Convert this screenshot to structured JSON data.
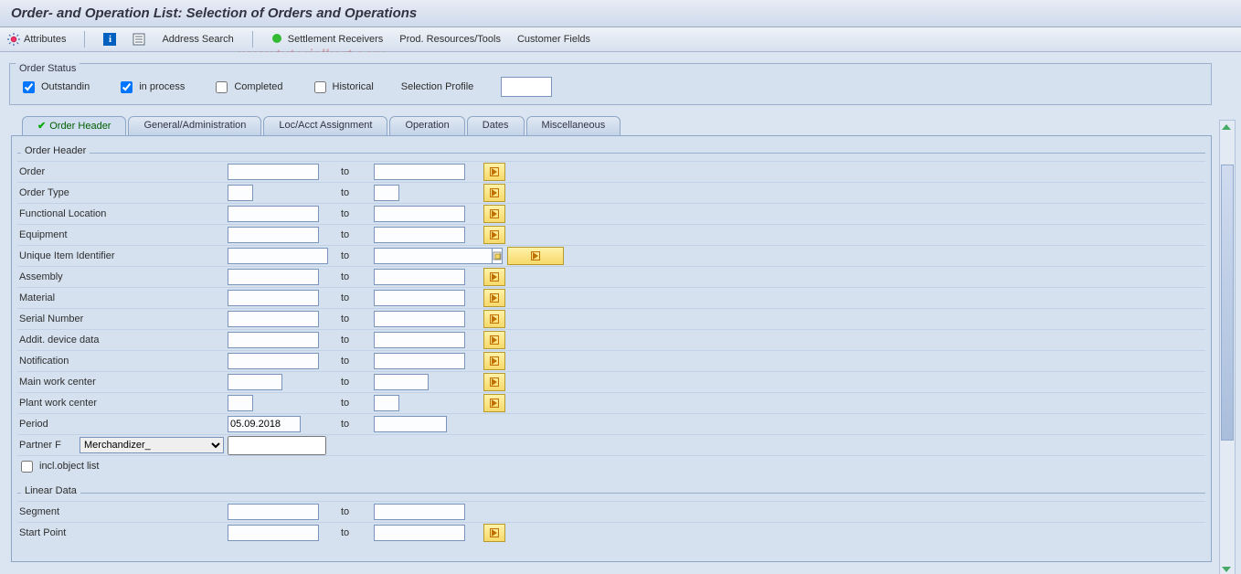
{
  "title": "Order- and Operation List: Selection of Orders and Operations",
  "watermark": "www.tutorialkart.com",
  "toolbar": {
    "attributes": "Attributes",
    "address_search": "Address Search",
    "settlement_receivers": "Settlement Receivers",
    "prod_resources_tools": "Prod. Resources/Tools",
    "customer_fields": "Customer Fields"
  },
  "order_status": {
    "legend": "Order Status",
    "outstanding": "Outstandin",
    "in_process": "in process",
    "completed": "Completed",
    "historical": "Historical",
    "selection_profile": "Selection Profile"
  },
  "tabs": {
    "order_header": "Order Header",
    "general_admin": "General/Administration",
    "loc_acct": "Loc/Acct Assignment",
    "operation": "Operation",
    "dates": "Dates",
    "miscellaneous": "Miscellaneous"
  },
  "group_header": "Order Header",
  "group_linear": "Linear Data",
  "to": "to",
  "fields": {
    "order": "Order",
    "order_type": "Order Type",
    "functional_location": "Functional Location",
    "equipment": "Equipment",
    "unique_item_identifier": "Unique Item Identifier",
    "assembly": "Assembly",
    "material": "Material",
    "serial_number": "Serial Number",
    "addit_device_data": "Addit. device data",
    "notification": "Notification",
    "main_work_center": "Main work center",
    "plant_work_center": "Plant work center",
    "period": "Period",
    "period_from_value": "05.09.2018",
    "partner_f": "Partner F",
    "partner_f_value": "Merchandizer_",
    "incl_object_list": "incl.object list",
    "segment": "Segment",
    "start_point": "Start Point"
  }
}
